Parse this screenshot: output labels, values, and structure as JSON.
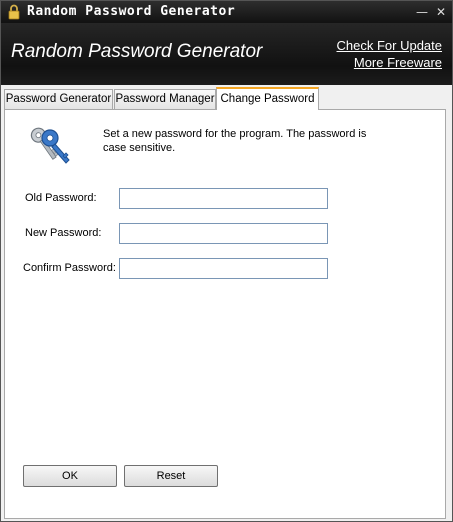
{
  "window": {
    "title": "Random Password Generator",
    "minimize_glyph": "—",
    "close_glyph": "✕"
  },
  "header": {
    "app_title": "Random Password Generator",
    "links": [
      "Check For Update",
      "More Freeware"
    ]
  },
  "tabs": [
    {
      "label": "Password Generator",
      "active": false
    },
    {
      "label": "Password Manager",
      "active": false
    },
    {
      "label": "Change Password",
      "active": true
    }
  ],
  "change_password": {
    "description": "Set a new password for the program. The password is case sensitive.",
    "fields": [
      {
        "label": "Old Password:",
        "value": ""
      },
      {
        "label": "New Password:",
        "value": ""
      },
      {
        "label": "Confirm Password:",
        "value": ""
      }
    ]
  },
  "buttons": {
    "ok": "OK",
    "reset": "Reset"
  },
  "colors": {
    "active_tab_accent": "#f5a623",
    "header_bg": "#1a1a1a",
    "input_border": "#7a96b5"
  },
  "icons": {
    "titlebar": "lock-icon",
    "panel": "keys-icon"
  }
}
